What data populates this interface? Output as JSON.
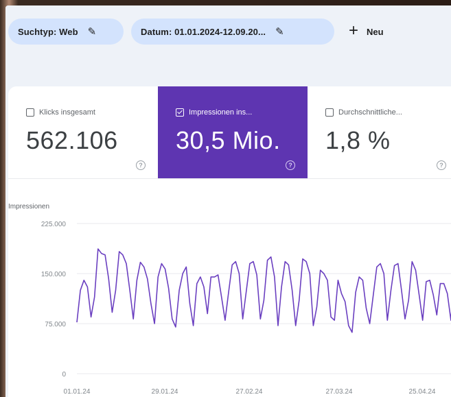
{
  "filters": {
    "search_type": "Suchtyp: Web",
    "date_range": "Datum: 01.01.2024-12.09.20...",
    "new_label": "Neu"
  },
  "metrics": [
    {
      "label": "Klicks insgesamt",
      "value": "562.106",
      "checked": false
    },
    {
      "label": "Impressionen ins...",
      "value": "30,5 Mio.",
      "checked": true
    },
    {
      "label": "Durchschnittliche...",
      "value": "1,8 %",
      "checked": false
    }
  ],
  "icons": {
    "edit": "pencil-icon",
    "add": "plus-icon",
    "help": "help-circle-icon",
    "checkbox": "checkbox-icon"
  },
  "colors": {
    "accent": "#5e35b1",
    "line": "#6a3fc0",
    "chip": "#d3e3fd"
  },
  "chart_data": {
    "type": "line",
    "ylabel": "Impressionen",
    "ylim": [
      0,
      225000
    ],
    "yticks": [
      0,
      75000,
      150000,
      225000
    ],
    "ytick_labels": [
      "0",
      "75.000",
      "150.000",
      "225.000"
    ],
    "xtick_labels": [
      "01.01.24",
      "29.01.24",
      "27.02.24",
      "27.03.24",
      "25.04.24"
    ],
    "grid": true,
    "series": [
      {
        "values": [
          77000,
          125000,
          140000,
          130000,
          85000,
          115000,
          187000,
          180000,
          178000,
          142000,
          92000,
          125000,
          183000,
          178000,
          165000,
          125000,
          82000,
          140000,
          167000,
          160000,
          142000,
          105000,
          75000,
          145000,
          165000,
          157000,
          128000,
          82000,
          70000,
          125000,
          150000,
          160000,
          105000,
          72000,
          135000,
          145000,
          130000,
          90000,
          145000,
          145000,
          148000,
          115000,
          80000,
          122000,
          163000,
          168000,
          150000,
          82000,
          123000,
          165000,
          168000,
          148000,
          82000,
          110000,
          170000,
          175000,
          145000,
          72000,
          130000,
          168000,
          163000,
          125000,
          72000,
          110000,
          172000,
          168000,
          150000,
          72000,
          100000,
          155000,
          150000,
          140000,
          85000,
          80000,
          140000,
          120000,
          108000,
          72000,
          62000,
          122000,
          145000,
          140000,
          98000,
          75000,
          118000,
          160000,
          165000,
          150000,
          80000,
          125000,
          162000,
          165000,
          125000,
          82000,
          110000,
          168000,
          155000,
          118000,
          80000,
          138000,
          140000,
          118000,
          88000,
          135000,
          135000,
          120000,
          80000,
          150000
        ]
      }
    ]
  }
}
